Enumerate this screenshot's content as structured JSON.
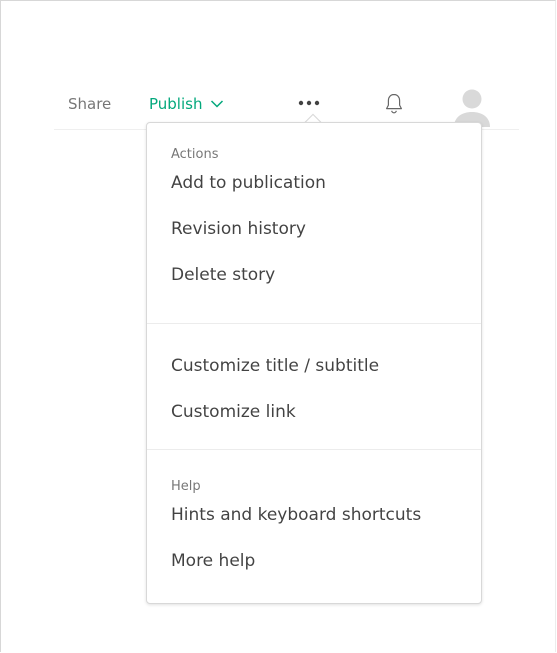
{
  "header": {
    "share_label": "Share",
    "publish_label": "Publish",
    "more_icon": "more-horizontal-icon",
    "notifications_icon": "bell-icon",
    "avatar_icon": "user-avatar-icon",
    "accent_color": "#03a87c"
  },
  "menu": {
    "sections": [
      {
        "label": "Actions",
        "items": [
          "Add to publication",
          "Revision history",
          "Delete story"
        ]
      },
      {
        "label": "",
        "items": [
          "Customize title / subtitle",
          "Customize link"
        ]
      },
      {
        "label": "Help",
        "items": [
          "Hints and keyboard shortcuts",
          "More help"
        ]
      }
    ]
  }
}
